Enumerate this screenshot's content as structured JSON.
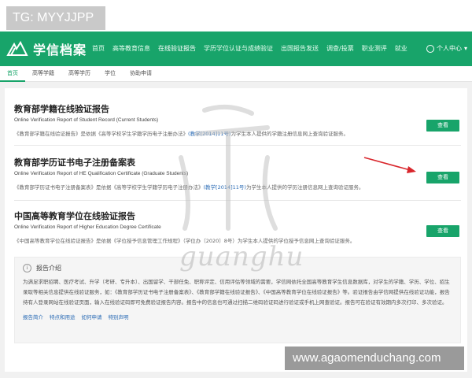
{
  "tag": "TG: MYYJJPP",
  "header": {
    "logo": "学信档案",
    "nav": [
      "首页",
      "高等教育信息",
      "在线验证报告",
      "学历学位认证与成绩验证",
      "出国报告发送",
      "调查/投票",
      "职业测评",
      "就业"
    ],
    "active_nav": 2,
    "user": "个人中心"
  },
  "subnav": [
    "首页",
    "高等学籍",
    "高等学历",
    "学位",
    "协助申请"
  ],
  "cards": [
    {
      "title": "教育部学籍在线验证报告",
      "en": "Online Verification Report of Student Record (Current Students)",
      "desc_a": "《教育部学籍在线验证报告》是依据《高等学校学生学籍学历电子注册办法》",
      "desc_link": "(教学[2014]11号)",
      "desc_b": "为学生本人提供的学籍注册信息网上查询验证服务。",
      "button": "查看"
    },
    {
      "title": "教育部学历证书电子注册备案表",
      "en": "Online Verification Report of HE Qualification Certificate (Graduate Students)",
      "desc_a": "《教育部学历证书电子注册备案表》是依据《高等学校学生学籍学历电子注册办法》",
      "desc_link": "(教学[2014]11号)",
      "desc_b": "为学生本人提供的学历注册信息网上查询验证服务。",
      "button": "查看"
    },
    {
      "title": "中国高等教育学位在线验证报告",
      "en": "Online Verification Report of Higher Education Degree Certificate",
      "desc_a": "《中国高等教育学位在线验证报告》是依据《学位授予信息管理工作规程》（学位办〔2020〕8号）为学生本人提供的学位授予信息网上查询验证服务。",
      "desc_link": "",
      "desc_b": "",
      "button": "查看"
    }
  ],
  "notice": {
    "title": "报告介绍",
    "body": "为满足求职招聘、医疗考试、升学（考研、专升本）、出国留学、干部任免、职称评定、信用评估等领域的需要，学信网依托全国高等教育学生信息数据库，对学生的学籍、学历、学位、招生录取等相关信息提供在线验证服务，如：《教育部学历证书电子注册备案表》、《教育部学籍在线验证报告》、《中国高等教育学位在线验证报告》等。验证报告由学信网提供在线验证功能，报告持有人登录网站在线验证页面，输入在线验证码即可免费验证报告内容。报告中的信息也可通过扫描二维码验证码进行验证或手机上网查验证。报告可在验证有效期内多次打印、多次验证。",
    "links": [
      "报告简介",
      "特点和用途",
      "如何申请",
      "特别声明"
    ]
  },
  "watermark": "guanghu",
  "site_banner": "www.agaomenduchang.com",
  "colors": {
    "brand": "#18a46a",
    "link": "#2a6bb5",
    "arrow": "#d9262c"
  }
}
